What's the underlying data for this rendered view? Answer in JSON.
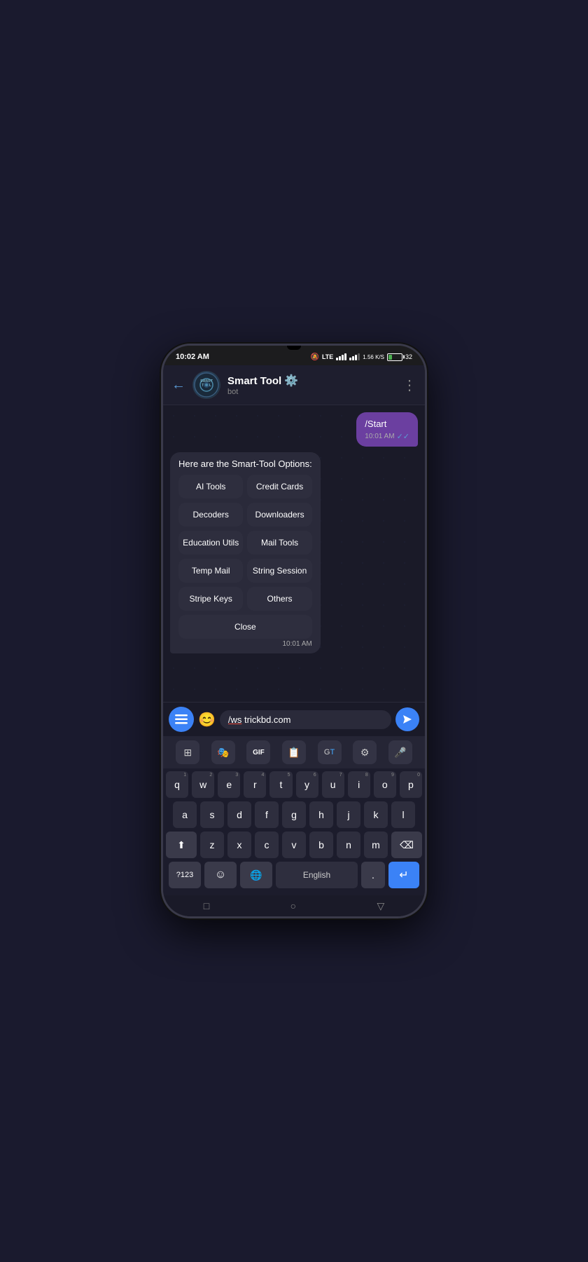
{
  "phone": {
    "status_bar": {
      "time": "10:02 AM",
      "network": "LTE",
      "speed": "1.56 K/S",
      "battery": "32"
    },
    "header": {
      "back_label": "←",
      "bot_name": "Smart Tool",
      "bot_status": "bot",
      "more_icon": "⋮"
    },
    "chat": {
      "sent_message": "/Start",
      "sent_time": "10:01 AM",
      "received_message": "Here are the Smart-Tool Options:",
      "received_time": "10:01 AM",
      "buttons": [
        {
          "label": "AI Tools",
          "id": "ai-tools"
        },
        {
          "label": "Credit Cards",
          "id": "credit-cards"
        },
        {
          "label": "Decoders",
          "id": "decoders"
        },
        {
          "label": "Downloaders",
          "id": "downloaders"
        },
        {
          "label": "Education Utils",
          "id": "education-utils"
        },
        {
          "label": "Mail Tools",
          "id": "mail-tools"
        },
        {
          "label": "Temp Mail",
          "id": "temp-mail"
        },
        {
          "label": "String Session",
          "id": "string-session"
        },
        {
          "label": "Stripe Keys",
          "id": "stripe-keys"
        },
        {
          "label": "Others",
          "id": "others"
        },
        {
          "label": "Close",
          "id": "close",
          "full_width": true
        }
      ]
    },
    "input": {
      "text": "/ws trickbd.com",
      "emoji_icon": "😊"
    },
    "keyboard": {
      "toolbar": [
        {
          "icon": "⊞",
          "name": "apps-icon"
        },
        {
          "icon": "🎭",
          "name": "stickers-icon"
        },
        {
          "icon": "GIF",
          "name": "gif-icon"
        },
        {
          "icon": "📋",
          "name": "clipboard-icon"
        },
        {
          "icon": "🌐",
          "name": "translate-icon"
        },
        {
          "icon": "⚙",
          "name": "settings-icon"
        },
        {
          "icon": "🎤",
          "name": "mic-icon"
        }
      ],
      "rows": [
        [
          "q",
          "w",
          "e",
          "r",
          "t",
          "y",
          "u",
          "i",
          "o",
          "p"
        ],
        [
          "a",
          "s",
          "d",
          "f",
          "g",
          "h",
          "j",
          "k",
          "l"
        ],
        [
          "z",
          "x",
          "c",
          "v",
          "b",
          "n",
          "m"
        ]
      ],
      "number_hints": [
        "1",
        "2",
        "3",
        "4",
        "5",
        "6",
        "7",
        "8",
        "9",
        "0"
      ],
      "space_label": "English",
      "special_labels": {
        "num": "?123",
        "period": ".",
        "enter_icon": "↵",
        "emoji": "☺",
        "globe": "🌐"
      }
    },
    "nav_bar": {
      "square_icon": "□",
      "circle_icon": "○",
      "triangle_icon": "▽"
    }
  }
}
